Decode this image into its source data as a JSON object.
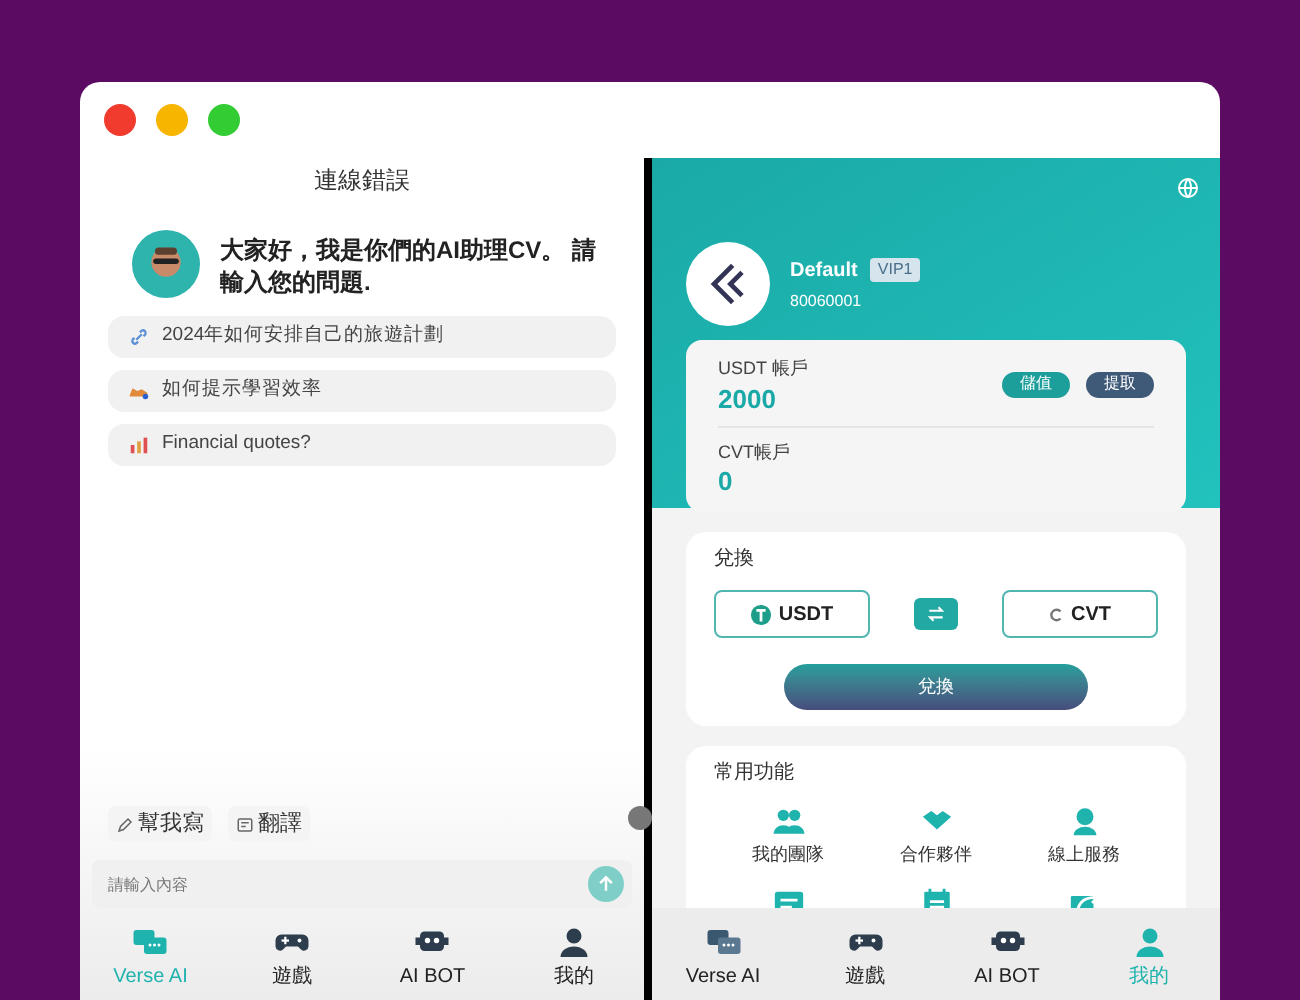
{
  "chat": {
    "title": "連線錯誤",
    "greeting": "大家好，我是你們的AI助理CV。 請輸入您的問題.",
    "suggestions": [
      {
        "kind": "link",
        "text": "2024年如何安排自己的旅遊計劃"
      },
      {
        "kind": "shoe",
        "text": "如何提示學習效率"
      },
      {
        "kind": "chart",
        "text": "Financial quotes?"
      }
    ],
    "tools": [
      {
        "kind": "write",
        "label": "幫我寫"
      },
      {
        "kind": "translate",
        "label": "翻譯"
      }
    ],
    "input": {
      "placeholder": "請輸入內容"
    },
    "nav": [
      {
        "kind": "chat",
        "label": "Verse AI",
        "selected": true
      },
      {
        "kind": "game",
        "label": "遊戲",
        "selected": false
      },
      {
        "kind": "bot",
        "label": "AI BOT",
        "selected": false
      },
      {
        "kind": "user",
        "label": "我的",
        "selected": false
      }
    ]
  },
  "profile": {
    "name": "Default",
    "badge": "VIP1",
    "id": "80060001",
    "accounts": [
      {
        "label": "USDT 帳戶",
        "amount": "2000",
        "actions": [
          {
            "kind": "deposit",
            "label": "儲值"
          },
          {
            "kind": "withdraw",
            "label": "提取"
          }
        ]
      },
      {
        "label": "CVT帳戶",
        "amount": "0"
      }
    ],
    "exchange": {
      "title": "兌換",
      "from": "USDT",
      "to": "CVT",
      "button": "兌換"
    },
    "functions": {
      "title": "常用功能",
      "items": [
        {
          "kind": "team",
          "label": "我的團隊"
        },
        {
          "kind": "partner",
          "label": "合作夥伴"
        },
        {
          "kind": "service",
          "label": "線上服務"
        },
        {
          "kind": "card"
        },
        {
          "kind": "calendar"
        },
        {
          "kind": "share"
        }
      ]
    },
    "nav": [
      {
        "kind": "chat",
        "label": "Verse AI",
        "selected": false
      },
      {
        "kind": "game",
        "label": "遊戲",
        "selected": false
      },
      {
        "kind": "bot",
        "label": "AI BOT",
        "selected": false
      },
      {
        "kind": "user",
        "label": "我的",
        "selected": true
      }
    ]
  }
}
